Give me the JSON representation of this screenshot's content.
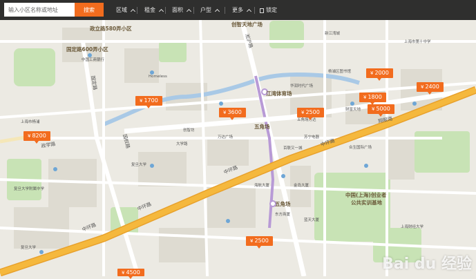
{
  "search": {
    "placeholder": "输入小区名称或地址",
    "button_label": "搜索"
  },
  "filters": [
    {
      "label": "区域"
    },
    {
      "label": "租金"
    },
    {
      "label": "面积"
    },
    {
      "label": "户型"
    },
    {
      "label": "更多"
    }
  ],
  "fixed_label": "锁定",
  "price_pins": [
    {
      "price": "1700"
    },
    {
      "price": "3600"
    },
    {
      "price": "8200"
    },
    {
      "price": "2500"
    },
    {
      "price": "2000"
    },
    {
      "price": "1800"
    },
    {
      "price": "5000"
    },
    {
      "price": "2400"
    },
    {
      "price": "2500"
    },
    {
      "price": "4500"
    }
  ],
  "currency_symbol": "¥",
  "labels": {
    "area1": "政立路580弄小区",
    "area2": "国定路600弄小区",
    "plaza1": "创智天地广场",
    "plaza2": "江湾体育场",
    "wujiaochang": "五角场",
    "wujiaochang2": "五角场",
    "road_zhonghuan": "中环路",
    "road_zhonghuan2": "中环路",
    "road_zhonghuan3": "中环路",
    "road_zhonghuan4": "中环路",
    "road_zhengli": "政立路",
    "road_guoding": "国定路",
    "road_songhu": "淞沪路",
    "road_xiangyin": "翔殷路",
    "road_guoquan": "国权路",
    "road_zhengxue": "政学路",
    "cy_park": "中国(上海)创业者",
    "cy_park2": "公共实训基地",
    "fudan": "复旦大学",
    "bank": "中国工商银行",
    "wanda": "万达广场",
    "hotel": "Homeless",
    "baike": "百联又一城",
    "lbl_a": "上海市杨浦",
    "lbl_b": "复旦大学",
    "lbl_c": "大学路",
    "lbl_d": "创智坊",
    "lbl_e": "新江湾城",
    "lbl_f": "东方商厦",
    "lbl_g": "合生国际广场",
    "lbl_h": "华润时代广场",
    "lbl_i": "上海市第十中学",
    "lbl_j": "杨浦区图书馆",
    "lbl_k": "财富天地",
    "lbl_l": "五角场万达",
    "lbl_m": "苏宁电器",
    "lbl_n": "海航大厦",
    "lbl_o": "金岛大厦",
    "lbl_p": "蓝天大厦",
    "lbl_q": "复旦大学附属中学",
    "lbl_r": "上海财经大学"
  },
  "watermark": "Bai du 经验",
  "colors": {
    "accent": "#f26c1e",
    "major_road": "#f5b83d",
    "water": "#a9c9e6",
    "green": "#c8e3b5",
    "metro": "#b89ad6"
  }
}
